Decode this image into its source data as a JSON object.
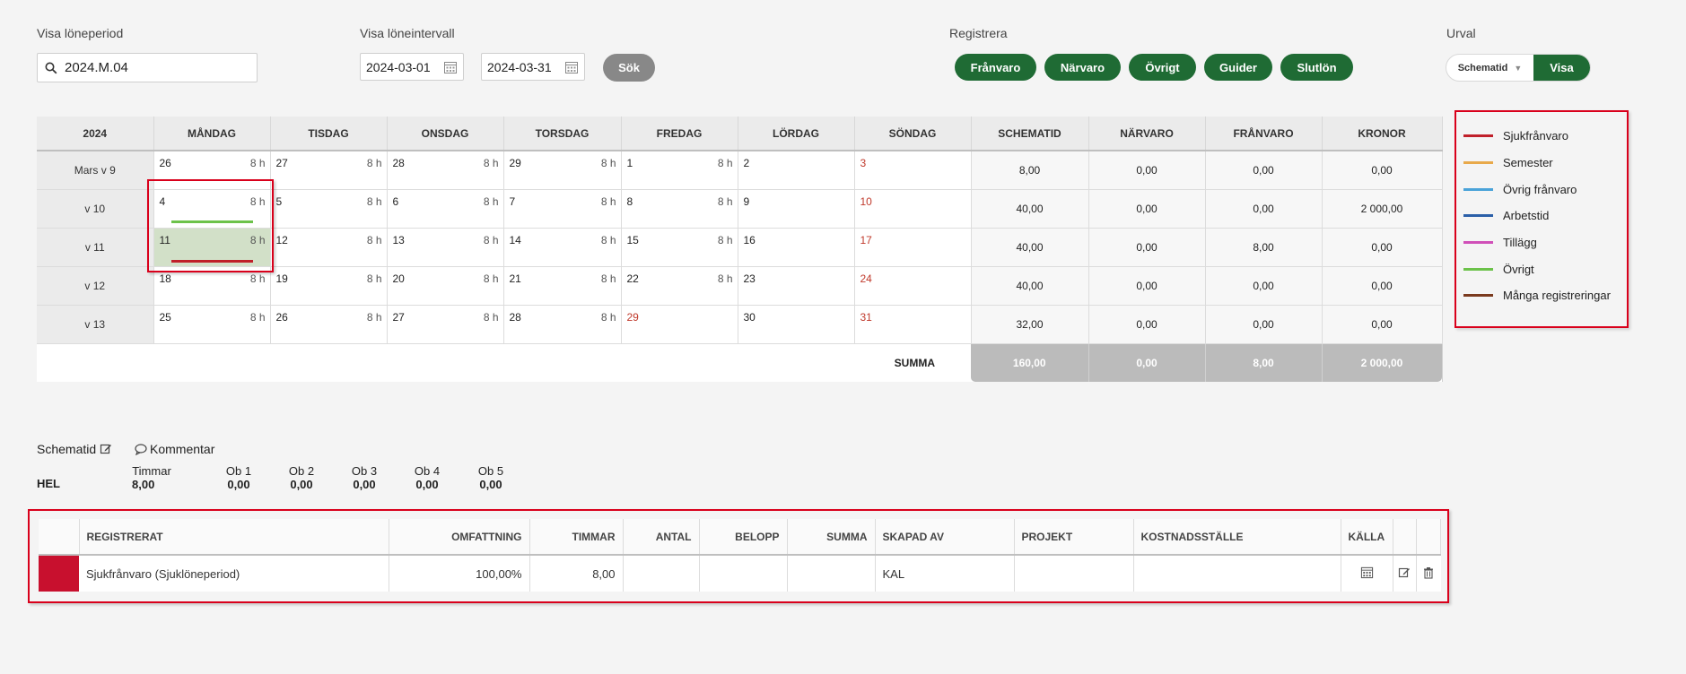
{
  "filters": {
    "period_label": "Visa löneperiod",
    "period_value": "2024.M.04",
    "interval_label": "Visa löneintervall",
    "date_from": "2024-03-01",
    "date_to": "2024-03-31",
    "search_button": "Sök",
    "register_label": "Registrera",
    "register_buttons": [
      "Frånvaro",
      "Närvaro",
      "Övrigt",
      "Guider",
      "Slutlön"
    ],
    "selection_label": "Urval",
    "selection_value": "Schematid",
    "show_button": "Visa"
  },
  "calendar": {
    "headers": [
      "2024",
      "MÅNDAG",
      "TISDAG",
      "ONSDAG",
      "TORSDAG",
      "FREDAG",
      "LÖRDAG",
      "SÖNDAG",
      "SCHEMATID",
      "NÄRVARO",
      "FRÅNVARO",
      "KRONOR"
    ],
    "rows": [
      {
        "week": "Mars v 9",
        "days": [
          [
            "26",
            "8 h"
          ],
          [
            "27",
            "8 h"
          ],
          [
            "28",
            "8 h"
          ],
          [
            "29",
            "8 h"
          ],
          [
            "1",
            "8 h"
          ],
          [
            "2",
            ""
          ],
          [
            "3",
            ""
          ]
        ],
        "sums": [
          "8,00",
          "0,00",
          "0,00",
          "0,00"
        ]
      },
      {
        "week": "v 10",
        "days": [
          [
            "4",
            "8 h"
          ],
          [
            "5",
            "8 h"
          ],
          [
            "6",
            "8 h"
          ],
          [
            "7",
            "8 h"
          ],
          [
            "8",
            "8 h"
          ],
          [
            "9",
            ""
          ],
          [
            "10",
            ""
          ]
        ],
        "sums": [
          "40,00",
          "0,00",
          "0,00",
          "2 000,00"
        ]
      },
      {
        "week": "v 11",
        "days": [
          [
            "11",
            "8 h"
          ],
          [
            "12",
            "8 h"
          ],
          [
            "13",
            "8 h"
          ],
          [
            "14",
            "8 h"
          ],
          [
            "15",
            "8 h"
          ],
          [
            "16",
            ""
          ],
          [
            "17",
            ""
          ]
        ],
        "sums": [
          "40,00",
          "0,00",
          "8,00",
          "0,00"
        ]
      },
      {
        "week": "v 12",
        "days": [
          [
            "18",
            "8 h"
          ],
          [
            "19",
            "8 h"
          ],
          [
            "20",
            "8 h"
          ],
          [
            "21",
            "8 h"
          ],
          [
            "22",
            "8 h"
          ],
          [
            "23",
            ""
          ],
          [
            "24",
            ""
          ]
        ],
        "sums": [
          "40,00",
          "0,00",
          "0,00",
          "0,00"
        ]
      },
      {
        "week": "v 13",
        "days": [
          [
            "25",
            "8 h"
          ],
          [
            "26",
            "8 h"
          ],
          [
            "27",
            "8 h"
          ],
          [
            "28",
            "8 h"
          ],
          [
            "29",
            ""
          ],
          [
            "30",
            ""
          ],
          [
            "31",
            ""
          ]
        ],
        "sums": [
          "32,00",
          "0,00",
          "0,00",
          "0,00"
        ]
      }
    ],
    "summa_label": "SUMMA",
    "summa_values": [
      "160,00",
      "0,00",
      "8,00",
      "2 000,00"
    ]
  },
  "legend": [
    {
      "label": "Sjukfrånvaro",
      "color": "#c0202a"
    },
    {
      "label": "Semester",
      "color": "#e8a94a"
    },
    {
      "label": "Övrig frånvaro",
      "color": "#4aa3d9"
    },
    {
      "label": "Arbetstid",
      "color": "#2b5fa8"
    },
    {
      "label": "Tillägg",
      "color": "#d04fb8"
    },
    {
      "label": "Övrigt",
      "color": "#6cc24a"
    },
    {
      "label": "Många registreringar",
      "color": "#7a3a1e"
    }
  ],
  "schedule": {
    "title": "Schematid",
    "comment": "Kommentar",
    "type": "HEL",
    "columns": [
      "Timmar",
      "Ob 1",
      "Ob 2",
      "Ob 3",
      "Ob 4",
      "Ob 5"
    ],
    "values": [
      "8,00",
      "0,00",
      "0,00",
      "0,00",
      "0,00",
      "0,00"
    ]
  },
  "registrations": {
    "headers": [
      "",
      "REGISTRERAT",
      "OMFATTNING",
      "TIMMAR",
      "ANTAL",
      "BELOPP",
      "SUMMA",
      "SKAPAD AV",
      "PROJEKT",
      "KOSTNADSSTÄLLE",
      "KÄLLA",
      "",
      ""
    ],
    "rows": [
      {
        "color": "#c8102e",
        "registrerat": "Sjukfrånvaro (Sjuklöneperiod)",
        "omfattning": "100,00%",
        "timmar": "8,00",
        "antal": "",
        "belopp": "",
        "summa": "",
        "skapad_av": "KAL",
        "projekt": "",
        "kostnadsstalle": ""
      }
    ]
  }
}
